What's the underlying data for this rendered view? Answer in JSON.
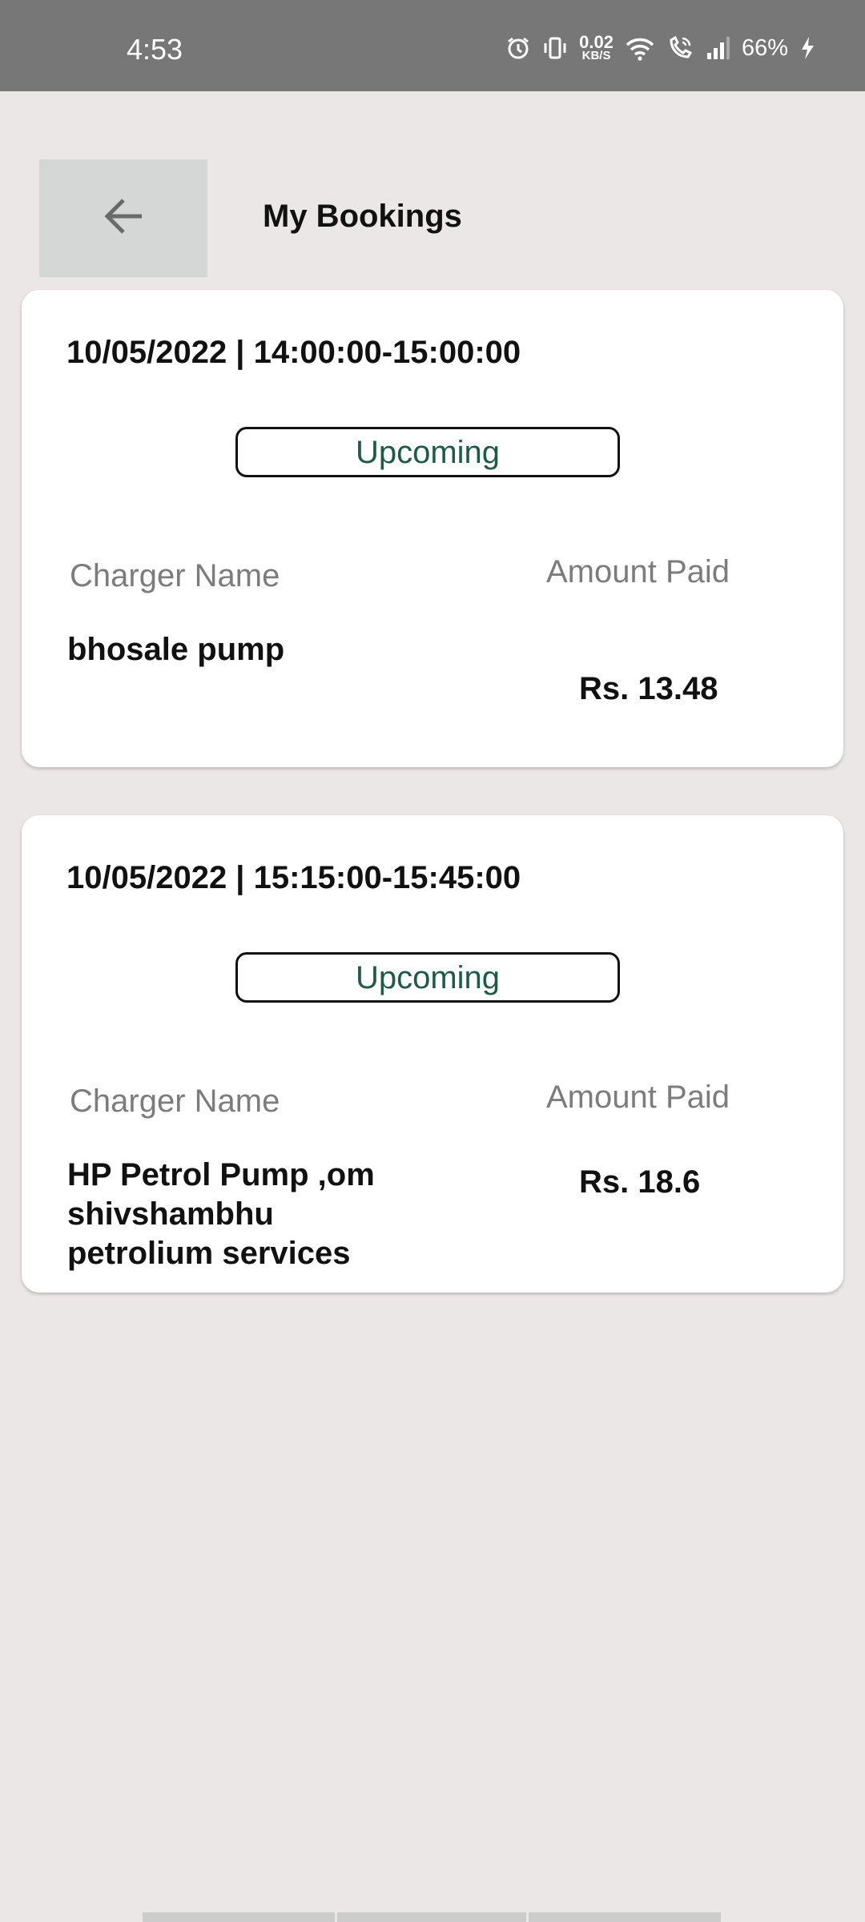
{
  "status_bar": {
    "time": "4:53",
    "net_speed_value": "0.02",
    "net_speed_unit": "KB/S",
    "battery": "66%"
  },
  "header": {
    "back_icon": "arrow-left-icon",
    "title": "My Bookings"
  },
  "bookings": [
    {
      "datetime": "10/05/2022 | 14:00:00-15:00:00",
      "status": "Upcoming",
      "charger_label": "Charger Name",
      "amount_label": "Amount Paid",
      "charger_name": "bhosale pump",
      "amount": "Rs. 13.48"
    },
    {
      "datetime": "10/05/2022 | 15:15:00-15:45:00",
      "status": "Upcoming",
      "charger_label": "Charger Name",
      "amount_label": "Amount Paid",
      "charger_name": "HP Petrol Pump ,om shivshambhu petrolium services",
      "amount": "Rs. 18.6"
    }
  ],
  "colors": {
    "background": "#ece7e7",
    "status_bar": "#777777",
    "status_text": "#1f5a47",
    "label_text": "#7c7c7c"
  }
}
